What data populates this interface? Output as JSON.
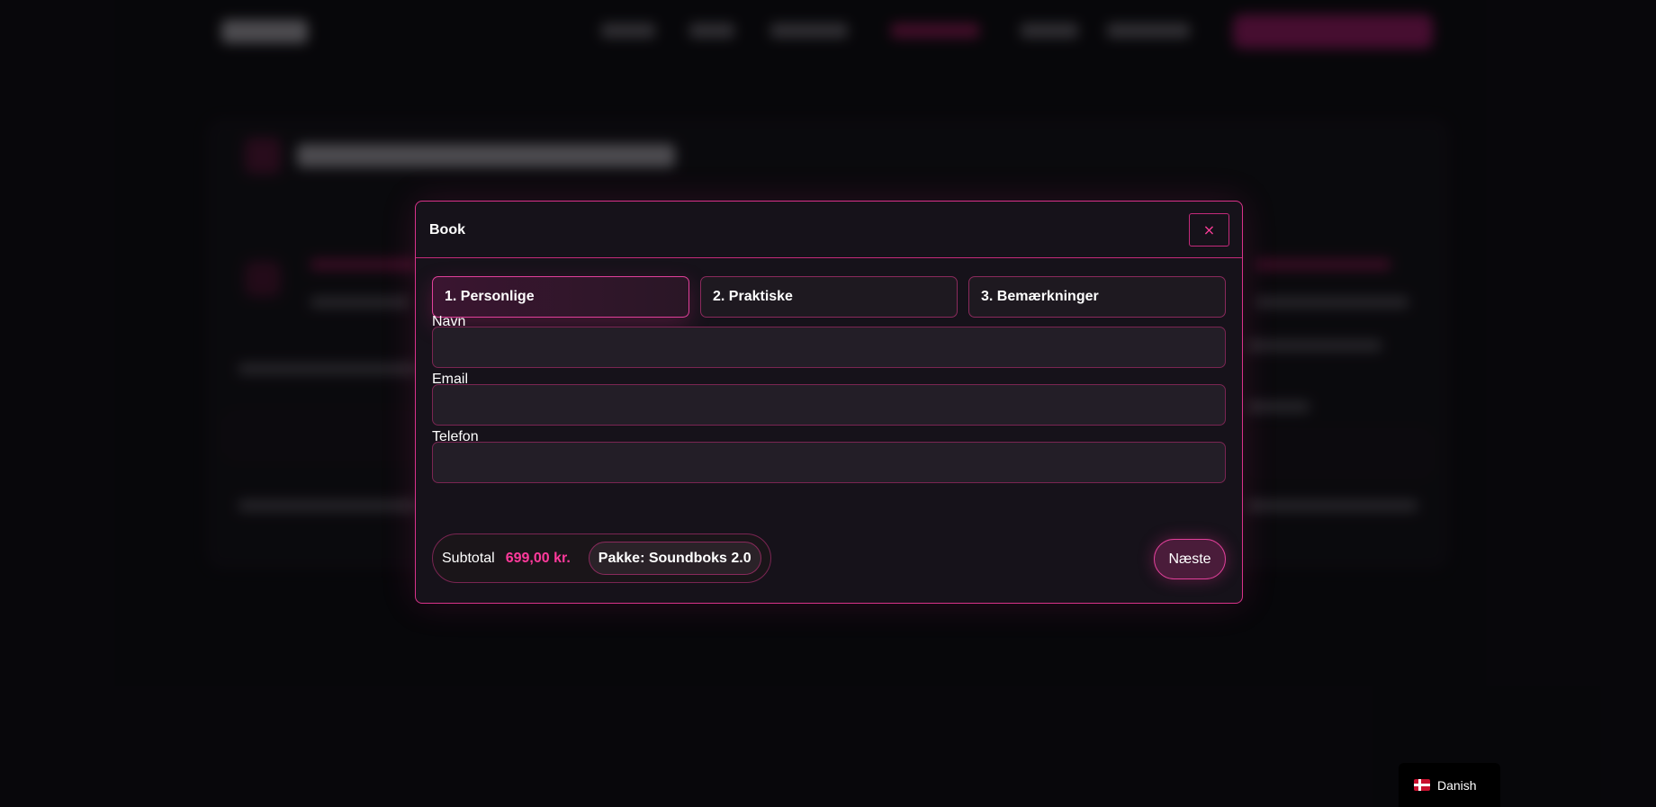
{
  "colors": {
    "accent": "#e0409a",
    "price": "#ff3a9c",
    "background": "#0b0a0e",
    "modal_background": "#16121a"
  },
  "modal": {
    "title": "Book",
    "close_label": "×",
    "steps": [
      {
        "label": "1. Personlige",
        "active": true
      },
      {
        "label": "2. Praktiske",
        "active": false
      },
      {
        "label": "3. Bemærkninger",
        "active": false
      }
    ],
    "fields": {
      "name": {
        "label": "Navn",
        "value": "",
        "placeholder": ""
      },
      "email": {
        "label": "Email",
        "value": "",
        "placeholder": ""
      },
      "phone": {
        "label": "Telefon",
        "value": "",
        "placeholder": ""
      }
    },
    "summary": {
      "subtotal_label": "Subtotal",
      "subtotal_value": "699,00 kr.",
      "package": "Pakke: Soundboks 2.0"
    },
    "next_label": "Næste"
  },
  "language_switcher": {
    "label": "Danish",
    "flag_icon": "denmark-flag-icon"
  }
}
